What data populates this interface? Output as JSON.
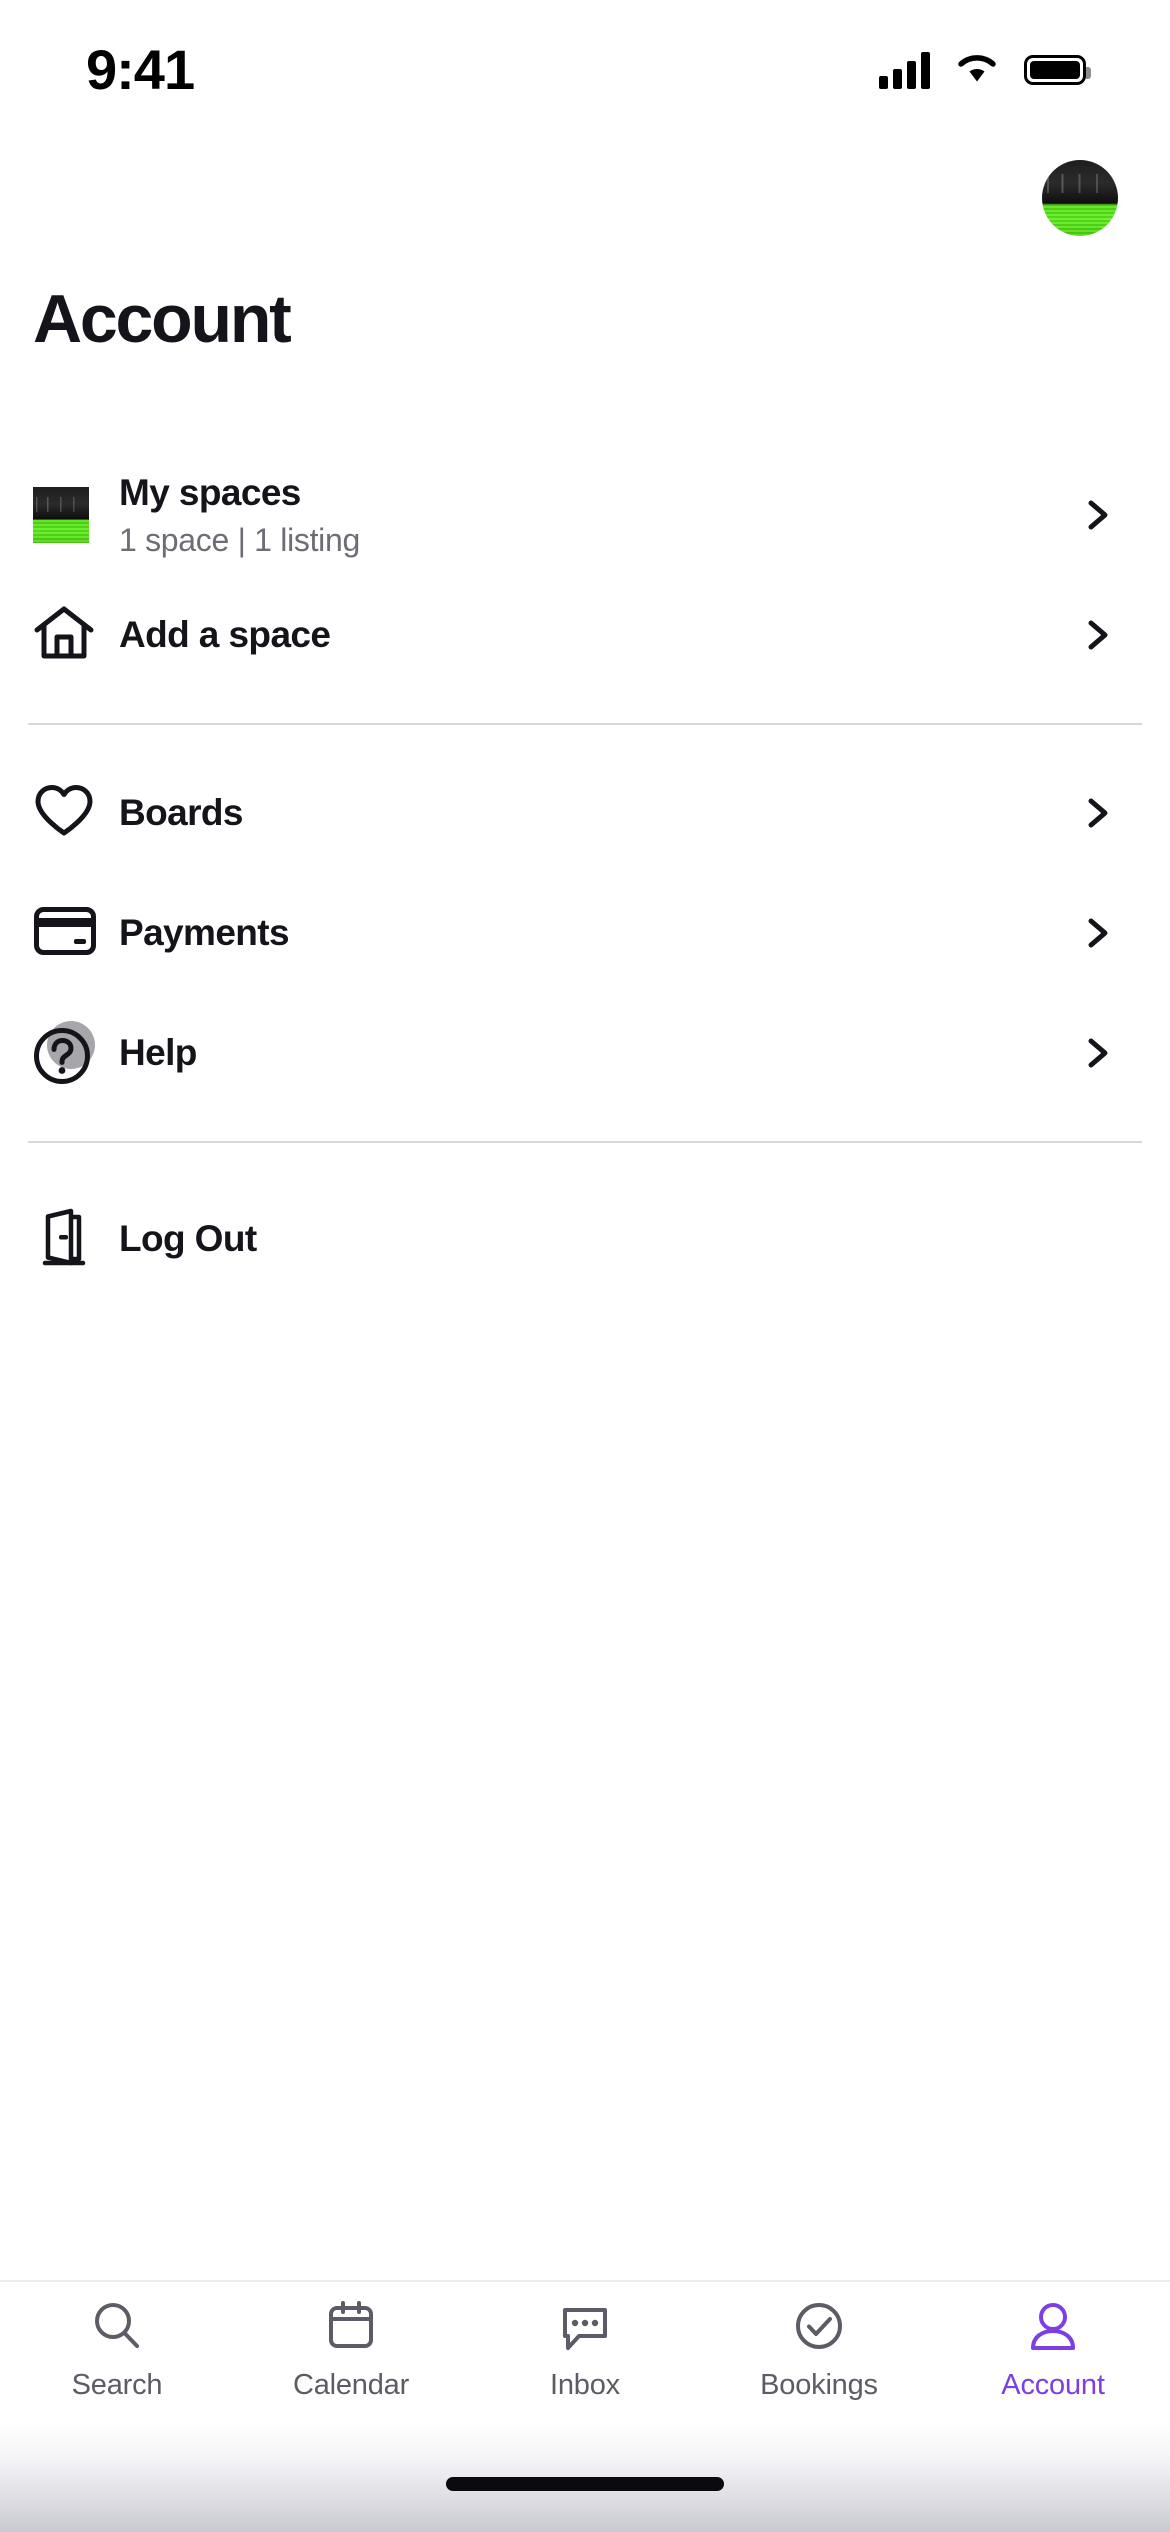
{
  "status_bar": {
    "time": "9:41",
    "cellular_icon": "cellular-bars-icon",
    "wifi_icon": "wifi-icon",
    "battery_icon": "battery-full-icon"
  },
  "header": {
    "title": "Account",
    "avatar_icon": "user-avatar-photo"
  },
  "menu": {
    "groups": [
      {
        "items": [
          {
            "id": "my-spaces",
            "label": "My spaces",
            "subtitle": "1 space | 1 listing",
            "icon": "space-thumbnail",
            "chevron": "chevron-right-icon"
          },
          {
            "id": "add-a-space",
            "label": "Add a space",
            "subtitle": "",
            "icon": "house-icon",
            "chevron": "chevron-right-icon"
          }
        ]
      },
      {
        "items": [
          {
            "id": "boards",
            "label": "Boards",
            "subtitle": "",
            "icon": "heart-icon",
            "chevron": "chevron-right-icon"
          },
          {
            "id": "payments",
            "label": "Payments",
            "subtitle": "",
            "icon": "credit-card-icon",
            "chevron": "chevron-right-icon"
          },
          {
            "id": "help",
            "label": "Help",
            "subtitle": "",
            "icon": "question-mark-circle-icon",
            "chevron": "chevron-right-icon"
          }
        ]
      },
      {
        "items": [
          {
            "id": "log-out",
            "label": "Log Out",
            "subtitle": "",
            "icon": "exit-door-icon",
            "chevron": ""
          }
        ]
      }
    ]
  },
  "tab_bar": {
    "active": "Account",
    "tabs": [
      {
        "id": "search",
        "label": "Search",
        "icon": "magnifier-icon"
      },
      {
        "id": "calendar",
        "label": "Calendar",
        "icon": "calendar-icon"
      },
      {
        "id": "inbox",
        "label": "Inbox",
        "icon": "chat-bubble-icon"
      },
      {
        "id": "bookings",
        "label": "Bookings",
        "icon": "check-circle-icon"
      },
      {
        "id": "account",
        "label": "Account",
        "icon": "person-icon"
      }
    ]
  },
  "colors": {
    "accent": "#7b3fe4",
    "text_primary": "#15141a",
    "text_secondary": "#6d6d75",
    "tab_inactive": "#5c5c66",
    "divider": "#d8d8dc",
    "thumbnail_green": "#52e014"
  },
  "home_indicator": "home-indicator-bar"
}
